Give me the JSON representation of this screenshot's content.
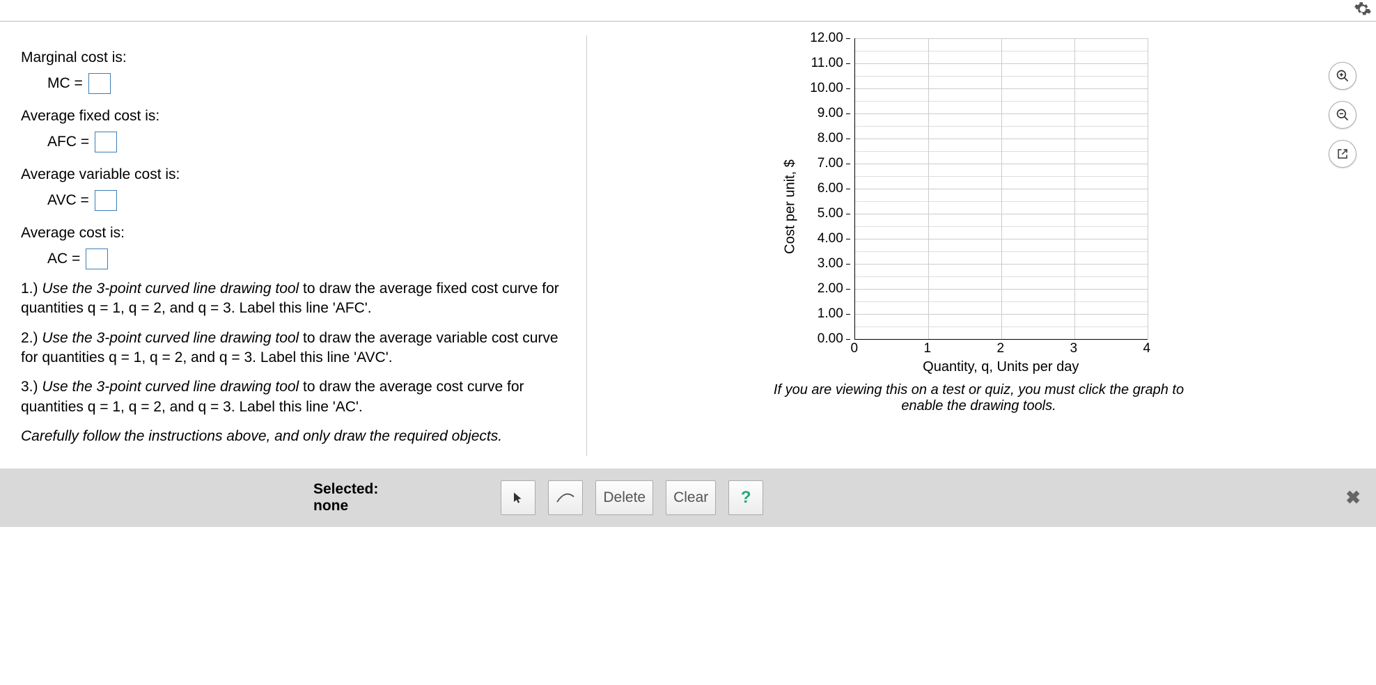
{
  "gear_icon": "gear",
  "question": {
    "p1": "Marginal cost is:",
    "mc_label": "MC =",
    "p2": "Average fixed cost is:",
    "afc_label": "AFC =",
    "p3": "Average variable cost is:",
    "avc_label": "AVC =",
    "p4": "Average cost is:",
    "ac_label": "AC =",
    "i1a": "1.) ",
    "i1b": "Use the 3-point curved line drawing tool",
    "i1c": " to draw the average fixed cost curve for quantities q = 1, q = 2, and q = 3. Label this line 'AFC'.",
    "i2a": "2.) ",
    "i2b": "Use the 3-point curved line drawing tool",
    "i2c": " to draw the average variable cost curve for quantities q = 1, q = 2, and q = 3. Label this line 'AVC'.",
    "i3a": "3.) ",
    "i3b": "Use the 3-point curved line drawing tool",
    "i3c": " to draw the average cost curve for quantities q = 1, q = 2, and q = 3. Label this line 'AC'.",
    "final": "Carefully follow the instructions above, and only draw the required objects."
  },
  "chart_data": {
    "type": "line",
    "title": "",
    "xlabel": "Quantity, q, Units per day",
    "ylabel": "Cost per unit, $",
    "xlim": [
      0,
      4
    ],
    "ylim": [
      0,
      12
    ],
    "xticks": [
      "0",
      "1",
      "2",
      "3",
      "4"
    ],
    "yticks": [
      "12.00",
      "11.00",
      "10.00",
      "9.00",
      "8.00",
      "7.00",
      "6.00",
      "5.00",
      "4.00",
      "3.00",
      "2.00",
      "1.00",
      "0.00"
    ],
    "series": []
  },
  "hint": "If you are viewing this on a test or quiz, you must click the graph to enable the drawing tools.",
  "toolbar": {
    "selected_label": "Selected:",
    "selected_value": "none",
    "delete": "Delete",
    "clear": "Clear",
    "help": "?"
  }
}
